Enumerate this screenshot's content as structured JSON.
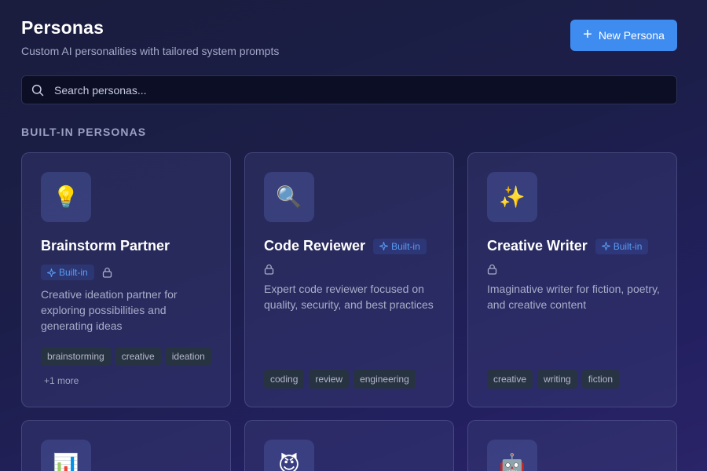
{
  "header": {
    "title": "Personas",
    "subtitle": "Custom AI personalities with tailored system prompts",
    "new_button_label": "New Persona"
  },
  "search": {
    "placeholder": "Search personas...",
    "value": ""
  },
  "section": {
    "title": "BUILT-IN PERSONAS"
  },
  "badge_label": "Built-in",
  "personas": [
    {
      "emoji": "💡",
      "name": "Brainstorm Partner",
      "description": "Creative ideation partner for exploring possibilities and generating ideas",
      "tags": [
        "brainstorming",
        "creative",
        "ideation"
      ],
      "more": "+1 more"
    },
    {
      "emoji": "🔍",
      "name": "Code Reviewer",
      "description": "Expert code reviewer focused on quality, security, and best practices",
      "tags": [
        "coding",
        "review",
        "engineering"
      ]
    },
    {
      "emoji": "✨",
      "name": "Creative Writer",
      "description": "Imaginative writer for fiction, poetry, and creative content",
      "tags": [
        "creative",
        "writing",
        "fiction"
      ]
    },
    {
      "emoji": "📊"
    },
    {
      "emoji": "😈"
    },
    {
      "emoji": "🤖"
    }
  ],
  "icons": {
    "search": "search-icon",
    "plus": "plus-icon",
    "sparkle": "sparkle-icon",
    "lock": "lock-icon"
  },
  "colors": {
    "accent": "#3f8cf0",
    "badge_text": "#5a9bf2",
    "background": "#1c1e4a"
  }
}
